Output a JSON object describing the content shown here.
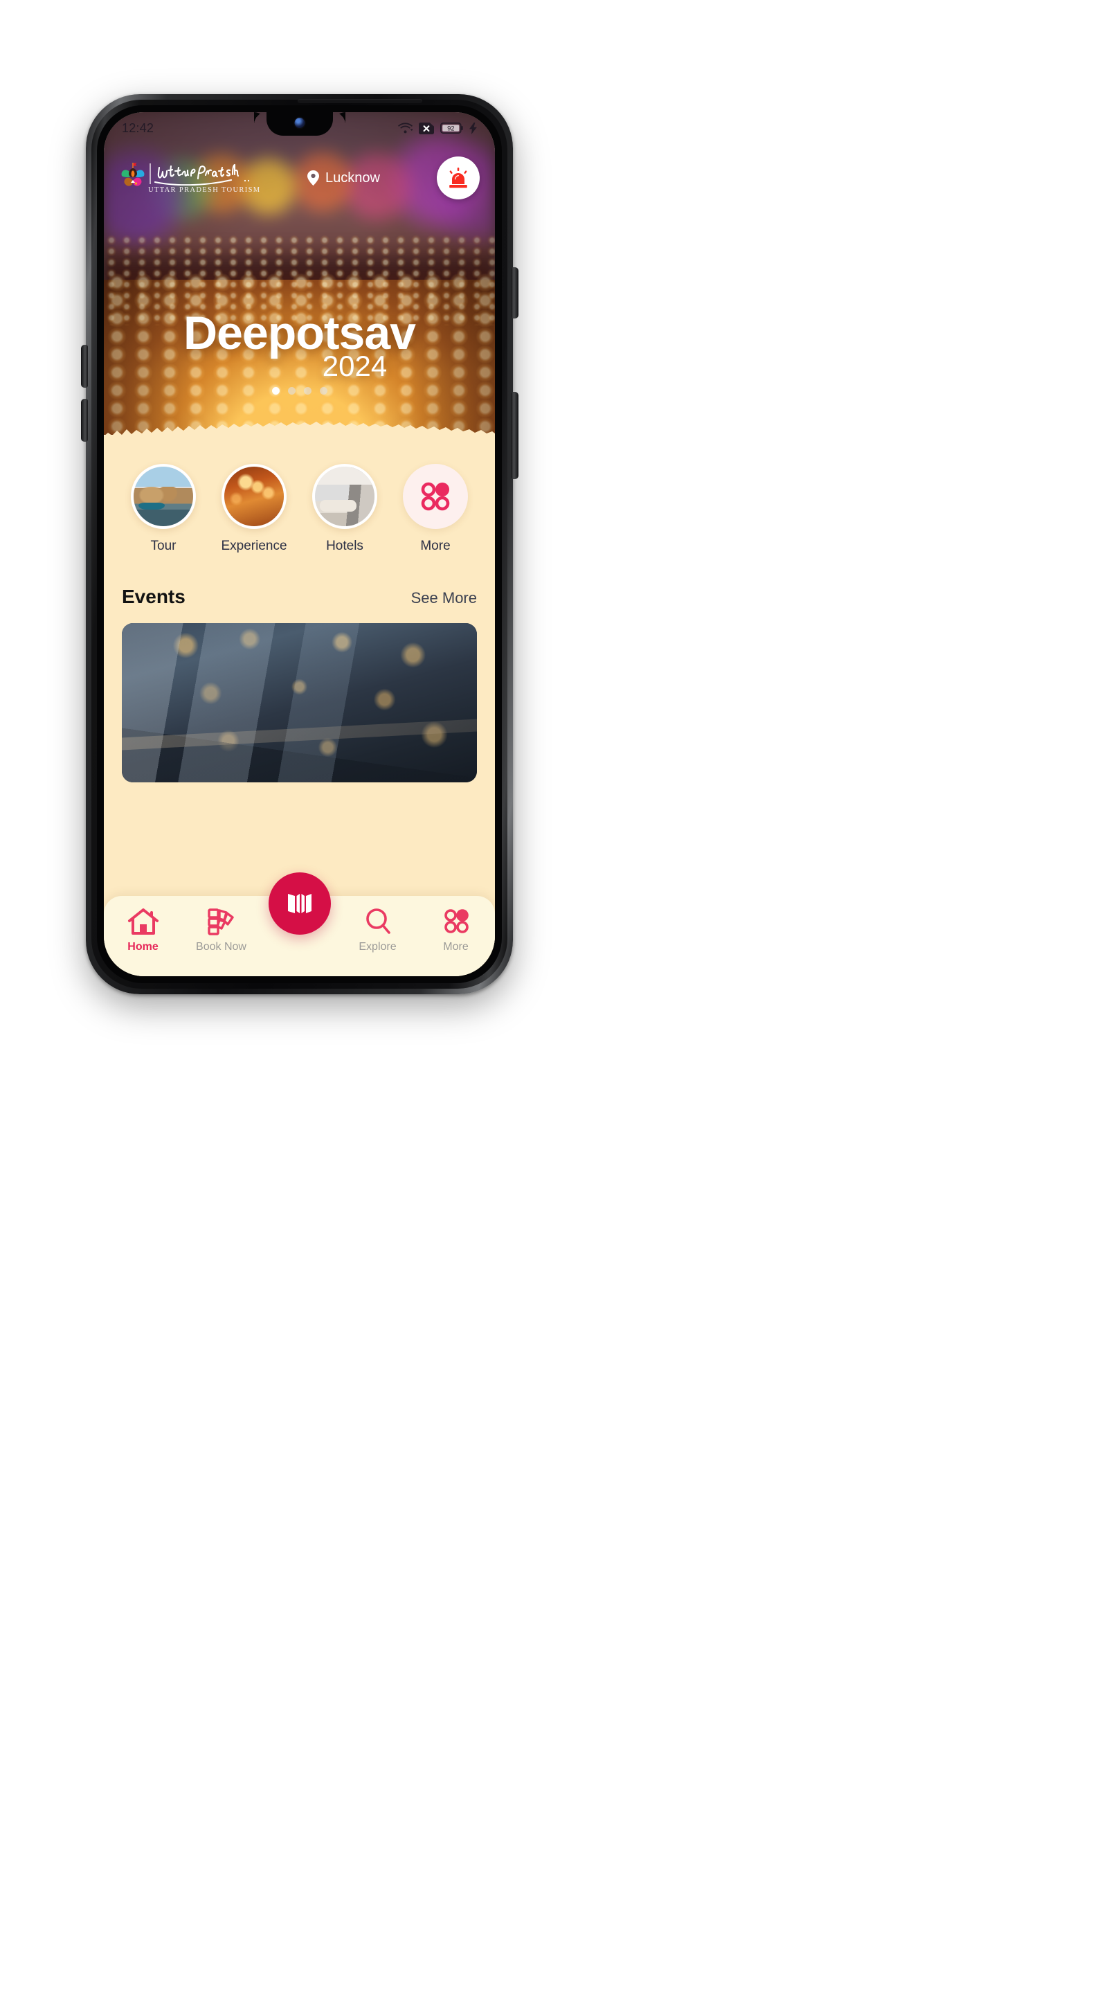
{
  "device": {
    "name": "android-phone-mockup",
    "frame_color": "#1c1c1e",
    "buttons": [
      "alert-slider",
      "power-button",
      "volume-up-button",
      "volume-down-button"
    ]
  },
  "status_bar": {
    "time": "12:42",
    "battery_level": "92",
    "icons": [
      "wifi-icon",
      "sim-card-disabled-icon",
      "battery-icon",
      "charging-bolt-icon"
    ]
  },
  "app_bar": {
    "brand_wordmark": "Uttar Pradesh",
    "brand_subtitle": "UTTAR PRADESH TOURISM",
    "brand_emblem_name": "up-tourism-petal-emblem",
    "location_label": "Lucknow",
    "location_icon": "map-pin-icon",
    "emergency_button_icon": "siren-alert-icon"
  },
  "hero": {
    "title": "Deepotsav",
    "year": "2024",
    "image_description": "Deepotsav diyas at Ayodhya ghats",
    "carousel": {
      "total": 4,
      "active_index": 0
    }
  },
  "quick_actions": [
    {
      "label": "Tour",
      "icon": "ghat-thumbnail"
    },
    {
      "label": "Experience",
      "icon": "aarti-thumbnail"
    },
    {
      "label": "Hotels",
      "icon": "hotel-room-thumbnail"
    },
    {
      "label": "More",
      "icon": "four-dot-grid-icon"
    }
  ],
  "events_section": {
    "title": "Events",
    "see_more_label": "See More",
    "card_image_description": "Aerial night view of illuminated event tent city"
  },
  "bottom_nav": {
    "items": [
      {
        "label": "Home",
        "icon": "home-icon",
        "active": true
      },
      {
        "label": "Book Now",
        "icon": "ticket-icon",
        "active": false
      },
      {
        "label": "Explore",
        "icon": "search-icon",
        "active": false
      },
      {
        "label": "More",
        "icon": "four-dot-grid-icon",
        "active": false
      }
    ],
    "center_button": {
      "icon": "map-fold-icon",
      "color": "#d50f46"
    }
  },
  "colors": {
    "accent": "#e6275a",
    "accent_deep": "#d50f46",
    "sheet_bg": "#fdeac2",
    "nav_bg": "#fdf7de",
    "text_dark": "#121212"
  }
}
